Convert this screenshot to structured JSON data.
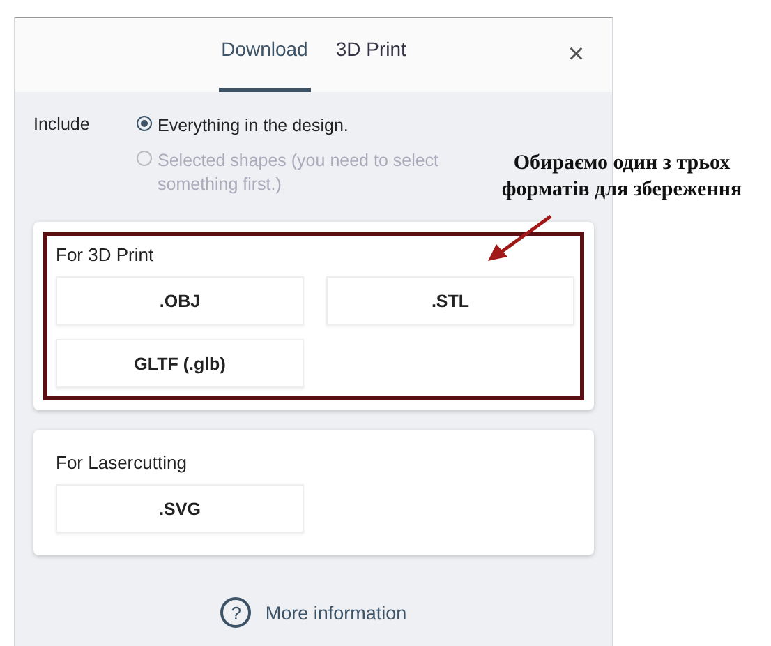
{
  "tabs": [
    {
      "label": "Download",
      "selected": true
    },
    {
      "label": "3D Print",
      "selected": false
    }
  ],
  "close": "×",
  "include": {
    "label": "Include",
    "options": [
      {
        "label": "Everything in the design.",
        "selected": true,
        "disabled": false
      },
      {
        "label": "Selected shapes (you need to select something first.)",
        "selected": false,
        "disabled": true
      }
    ]
  },
  "sections": [
    {
      "title": "For 3D Print",
      "highlighted": true,
      "buttons": [
        ".OBJ",
        ".STL",
        "GLTF (.glb)"
      ]
    },
    {
      "title": "For Lasercutting",
      "highlighted": false,
      "buttons": [
        ".SVG"
      ]
    }
  ],
  "more_info": {
    "icon": "?",
    "label": "More information"
  },
  "annotation": {
    "text": "Обираємо один з трьох форматів для збереження"
  }
}
